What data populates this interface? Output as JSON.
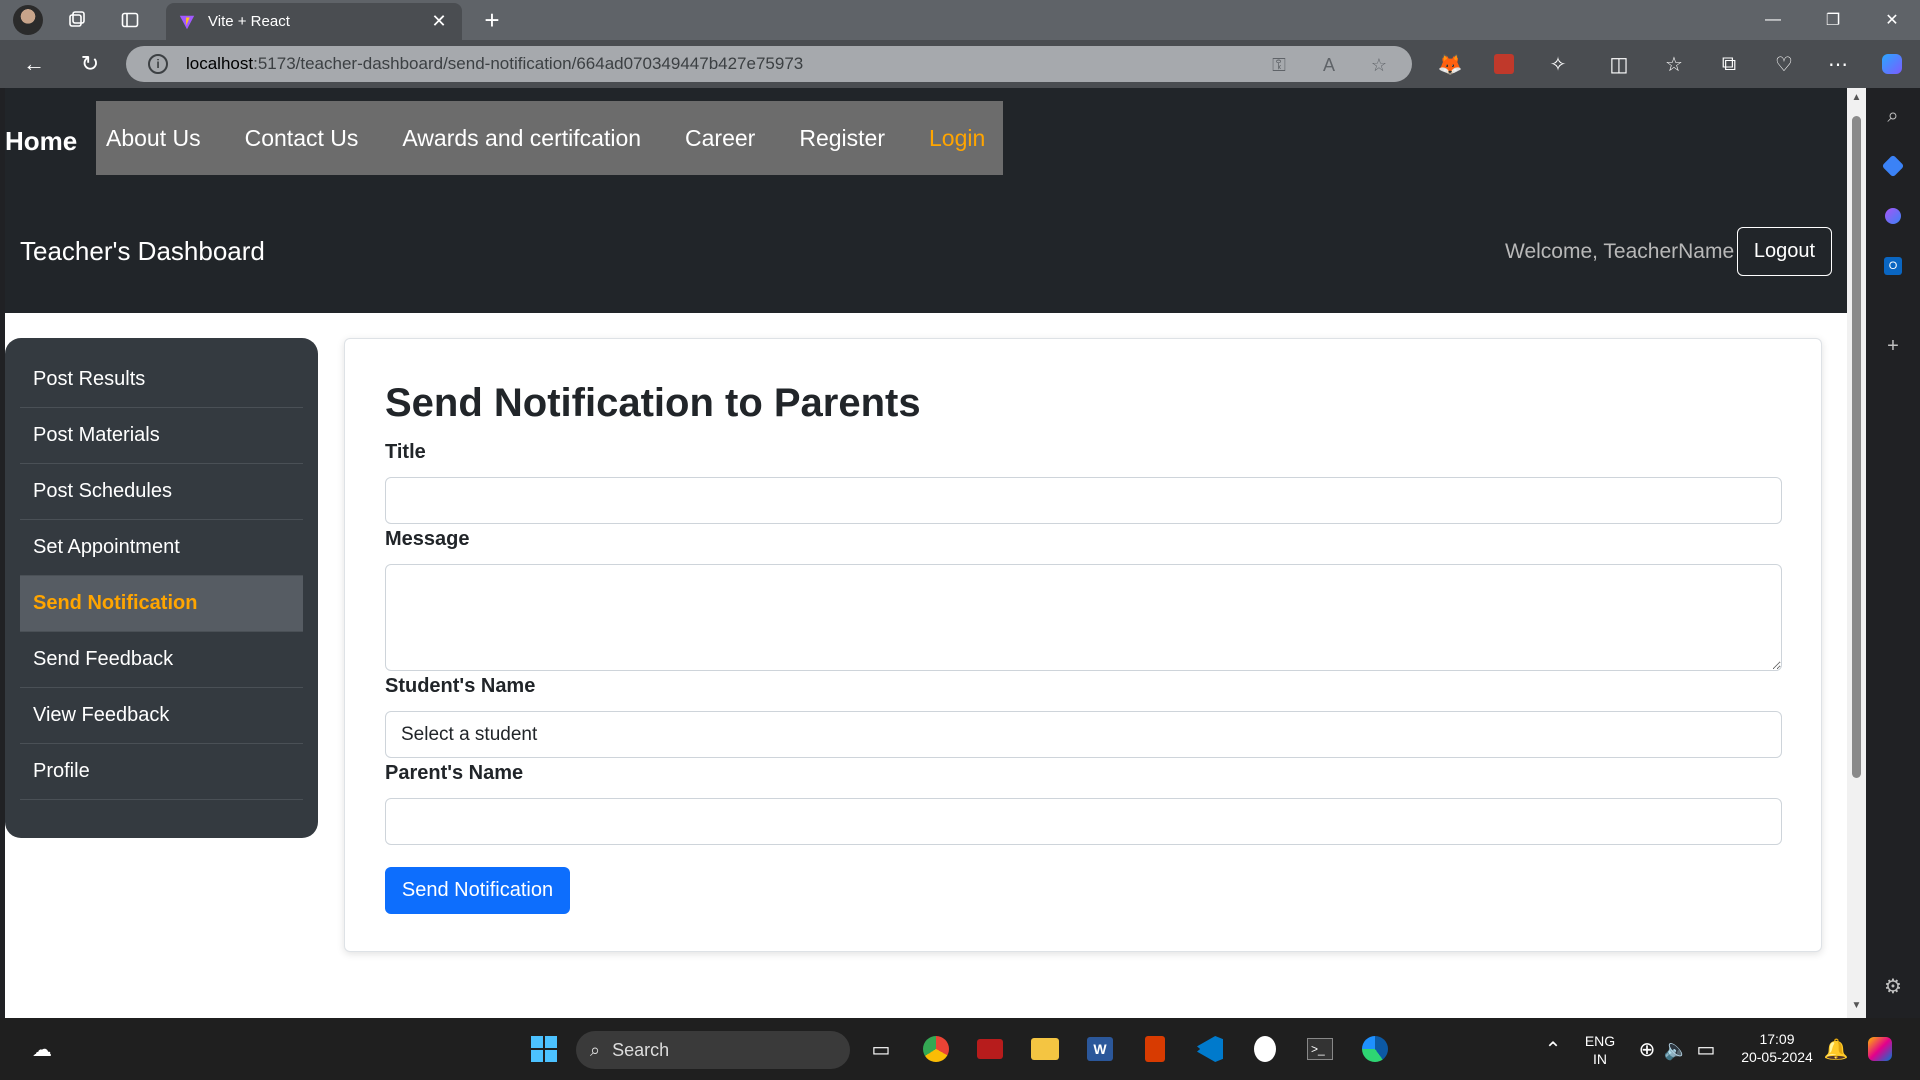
{
  "browser": {
    "tab_title": "Vite + React",
    "url_host": "localhost",
    "url_path": ":5173/teacher-dashboard/send-notification/664ad070349447b427e75973"
  },
  "nav": {
    "home": "Home",
    "items": [
      "About Us",
      "Contact Us",
      "Awards and certifcation",
      "Career",
      "Register",
      "Login"
    ],
    "login_color": "#ffa500"
  },
  "header": {
    "title": "Teacher's Dashboard",
    "welcome": "Welcome, TeacherName",
    "logout": "Logout"
  },
  "sidebar": {
    "items": [
      {
        "label": "Post Results"
      },
      {
        "label": "Post Materials"
      },
      {
        "label": "Post Schedules"
      },
      {
        "label": "Set Appointment"
      },
      {
        "label": "Send Notification",
        "active": true
      },
      {
        "label": "Send Feedback"
      },
      {
        "label": "View Feedback"
      },
      {
        "label": "Profile"
      }
    ]
  },
  "form": {
    "heading": "Send Notification to Parents",
    "title_label": "Title",
    "title_value": "",
    "message_label": "Message",
    "message_value": "",
    "student_label": "Student's Name",
    "student_selected": "Select a student",
    "parent_label": "Parent's Name",
    "parent_value": "",
    "submit": "Send Notification",
    "submit_color": "#0d6efd"
  },
  "taskbar": {
    "search": "Search",
    "lang_top": "ENG",
    "lang_bottom": "IN",
    "time": "17:09",
    "date": "20-05-2024"
  }
}
